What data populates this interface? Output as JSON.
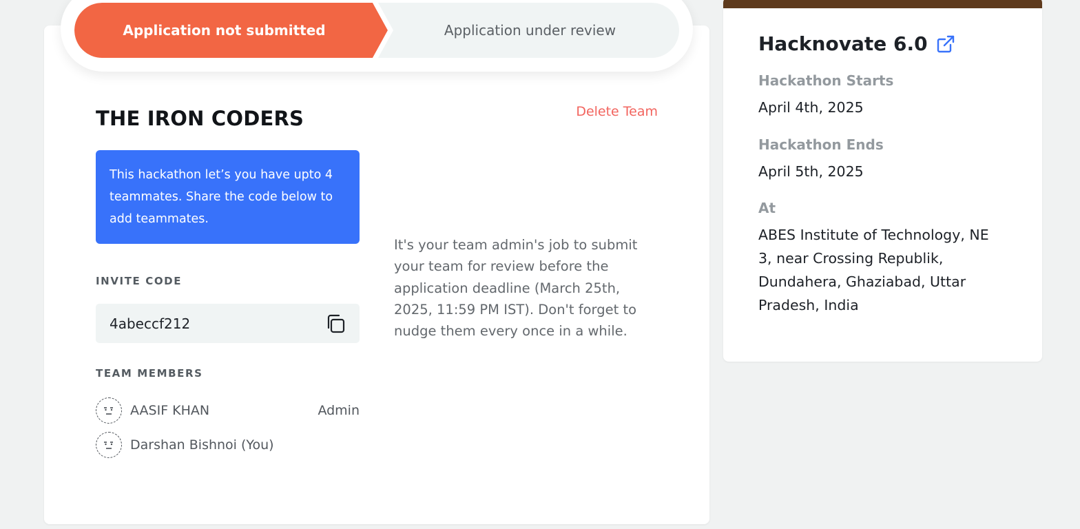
{
  "steps": {
    "current": "Application not submitted",
    "next": "Application under review"
  },
  "team": {
    "name": "THE IRON CODERS",
    "delete_label": "Delete Team",
    "info_text": "This hackathon let’s you have upto 4 teammates. Share the code below to add teammates.",
    "invite_label": "INVITE CODE",
    "invite_code": "4abeccf212",
    "members_label": "TEAM MEMBERS",
    "members": [
      {
        "name": "AASIF KHAN",
        "role": "Admin"
      },
      {
        "name": "Darshan Bishnoi (You)",
        "role": ""
      }
    ],
    "admin_note": "It's your team admin's job to submit your team for review before the application deadline (March 25th, 2025, 11:59 PM IST). Don't forget to nudge them every once in a while."
  },
  "event": {
    "banner_color": "#5e3a1c",
    "title": "Hacknovate 6.0",
    "start_label": "Hackathon Starts",
    "start_date": "April 4th, 2025",
    "end_label": "Hackathon Ends",
    "end_date": "April 5th, 2025",
    "location_label": "At",
    "location": "ABES Institute of Technology, NE 3, near Crossing Republik, Dundahera, Ghaziabad, Uttar Pradesh, India"
  },
  "colors": {
    "accent_orange": "#f26644",
    "info_blue": "#3872fa",
    "danger": "#f2645e",
    "link_blue": "#3872fa"
  }
}
